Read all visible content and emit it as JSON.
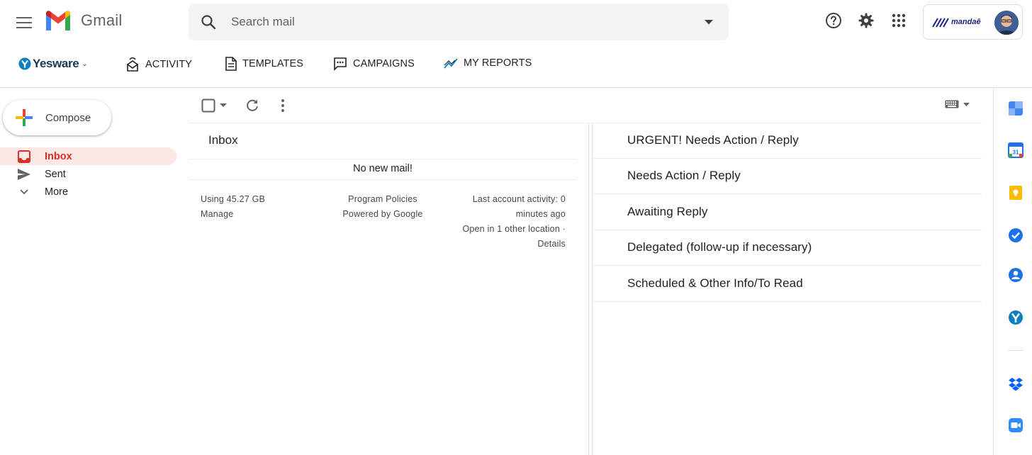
{
  "app": {
    "name": "Gmail"
  },
  "search": {
    "placeholder": "Search mail",
    "value": ""
  },
  "account": {
    "org_name": "mandaê"
  },
  "yesware": {
    "brand": "Yesware",
    "nav": [
      {
        "label": "ACTIVITY",
        "icon": "activity-icon"
      },
      {
        "label": "TEMPLATES",
        "icon": "document-icon"
      },
      {
        "label": "CAMPAIGNS",
        "icon": "chat-bubble-icon"
      },
      {
        "label": "MY REPORTS",
        "icon": "trend-line-icon"
      }
    ]
  },
  "sidebar": {
    "compose_label": "Compose",
    "items": [
      {
        "label": "Inbox",
        "icon": "inbox-icon",
        "active": true
      },
      {
        "label": "Sent",
        "icon": "send-icon",
        "active": false
      },
      {
        "label": "More",
        "icon": "chevron-down-icon",
        "active": false
      }
    ]
  },
  "inbox": {
    "title": "Inbox",
    "empty_message": "No new mail!"
  },
  "footer": {
    "storage": "Using 45.27 GB",
    "manage": "Manage",
    "policies": "Program Policies",
    "powered": "Powered by Google",
    "activity_line1": "Last account activity: 0",
    "activity_line2": "minutes ago",
    "activity_line3": "Open in 1 other location ·",
    "details": "Details"
  },
  "sections": [
    {
      "label": "URGENT! Needs Action / Reply"
    },
    {
      "label": "Needs Action / Reply"
    },
    {
      "label": "Awaiting Reply"
    },
    {
      "label": "Delegated (follow-up if necessary)"
    },
    {
      "label": "Scheduled & Other Info/To Read"
    }
  ],
  "side_panel": [
    {
      "name": "calendar-app-icon",
      "color": "#4285f4"
    },
    {
      "name": "google-calendar-icon",
      "color": "#1a73e8"
    },
    {
      "name": "keep-icon",
      "color": "#fbbc04"
    },
    {
      "name": "tasks-icon",
      "color": "#1a73e8"
    },
    {
      "name": "contacts-icon",
      "color": "#1a73e8"
    },
    {
      "name": "yesware-icon",
      "color": "#0b7fc1"
    },
    {
      "name": "dropbox-icon",
      "color": "#0061fe"
    },
    {
      "name": "zoom-icon",
      "color": "#2d8cff"
    }
  ],
  "colors": {
    "accent_red": "#d93025",
    "active_bg": "#fce8e6",
    "search_bg": "#f1f3f4",
    "yesware_navy": "#1d3557"
  }
}
